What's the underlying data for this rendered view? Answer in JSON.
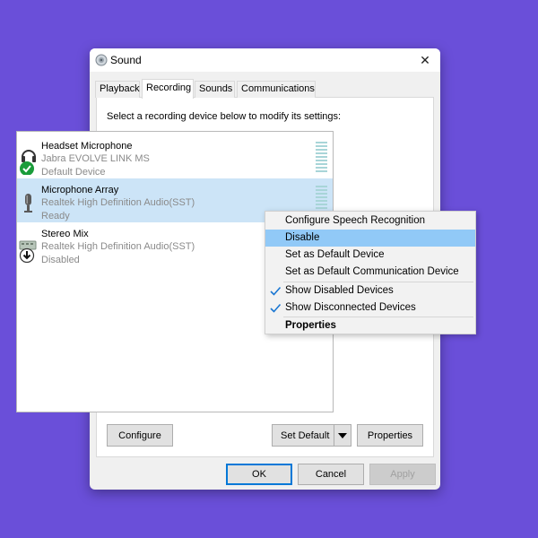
{
  "window": {
    "title": "Sound",
    "close_glyph": "✕"
  },
  "tabs": [
    {
      "label": "Playback",
      "active": false
    },
    {
      "label": "Recording",
      "active": true
    },
    {
      "label": "Sounds",
      "active": false
    },
    {
      "label": "Communications",
      "active": false
    }
  ],
  "instruction": "Select a recording device below to modify its settings:",
  "devices": [
    {
      "name": "Headset Microphone",
      "driver": "Jabra EVOLVE LINK MS",
      "status": "Default Device",
      "icon": "headset-icon",
      "badge": "default-check-badge",
      "selected": false
    },
    {
      "name": "Microphone Array",
      "driver": "Realtek High Definition Audio(SST)",
      "status": "Ready",
      "icon": "microphone-icon",
      "badge": "",
      "selected": true
    },
    {
      "name": "Stereo Mix",
      "driver": "Realtek High Definition Audio(SST)",
      "status": "Disabled",
      "icon": "stereo-mix-icon",
      "badge": "disabled-arrow-badge",
      "selected": false
    }
  ],
  "buttons": {
    "configure": "Configure",
    "set_default": "Set Default",
    "properties": "Properties",
    "ok": "OK",
    "cancel": "Cancel",
    "apply": "Apply"
  },
  "context_menu": {
    "items": [
      {
        "label": "Configure Speech Recognition",
        "highlighted": false,
        "checked": false,
        "bold": false
      },
      {
        "label": "Disable",
        "highlighted": true,
        "checked": false,
        "bold": false
      },
      {
        "label": "Set as Default Device",
        "highlighted": false,
        "checked": false,
        "bold": false
      },
      {
        "label": "Set as Default Communication Device",
        "highlighted": false,
        "checked": false,
        "bold": false
      },
      {
        "label": "Show Disabled Devices",
        "highlighted": false,
        "checked": true,
        "bold": false
      },
      {
        "label": "Show Disconnected Devices",
        "highlighted": false,
        "checked": true,
        "bold": false
      },
      {
        "label": "Properties",
        "highlighted": false,
        "checked": false,
        "bold": true
      }
    ]
  },
  "colors": {
    "background": "#6a4fd9",
    "selection": "#cce4f7",
    "menu_highlight": "#91c9f7",
    "check": "#1976d2",
    "default_badge": "#1a9c3a",
    "primary_border": "#0078d7"
  }
}
